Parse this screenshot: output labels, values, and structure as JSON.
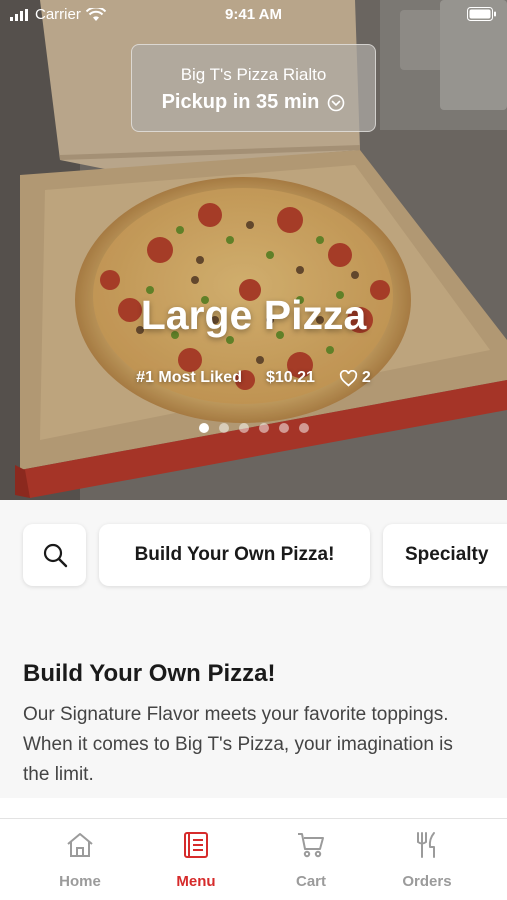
{
  "status_bar": {
    "carrier": "Carrier",
    "time": "9:41 AM"
  },
  "pickup": {
    "store": "Big T's Pizza Rialto",
    "eta": "Pickup in 35 min"
  },
  "hero": {
    "title": "Large Pizza",
    "rank": "#1 Most Liked",
    "price": "$10.21",
    "likes": "2",
    "slides": 6,
    "active_slide": 1
  },
  "categories": {
    "search_icon": "search-icon",
    "items": [
      "Build Your Own Pizza!",
      "Specialty"
    ]
  },
  "section": {
    "title": "Build Your Own Pizza!",
    "description": "Our Signature Flavor meets your favorite toppings. When it comes to Big T's Pizza, your imagination is the limit."
  },
  "tabs": [
    {
      "label": "Home",
      "icon": "home-icon",
      "active": false
    },
    {
      "label": "Menu",
      "icon": "menu-icon",
      "active": true
    },
    {
      "label": "Cart",
      "icon": "cart-icon",
      "active": false
    },
    {
      "label": "Orders",
      "icon": "orders-icon",
      "active": false
    }
  ],
  "colors": {
    "accent": "#d62b2b",
    "inactive": "#9b9b9b",
    "background": "#f7f7f7"
  }
}
